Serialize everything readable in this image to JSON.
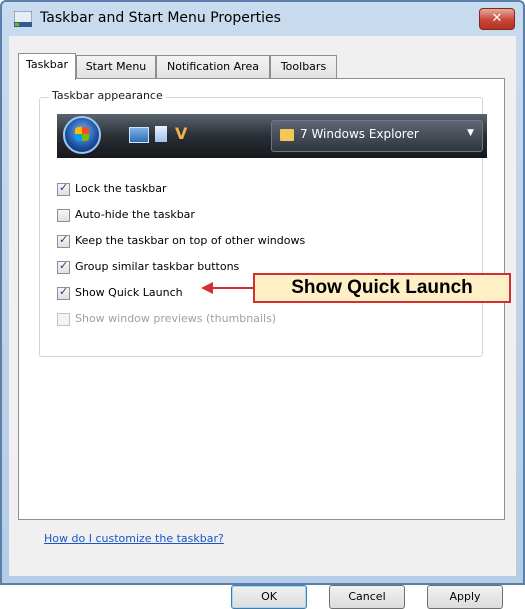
{
  "window": {
    "title": "Taskbar and Start Menu Properties",
    "close_label": "✕"
  },
  "tabs": [
    {
      "label": "Taskbar",
      "active": true
    },
    {
      "label": "Start Menu",
      "active": false
    },
    {
      "label": "Notification Area",
      "active": false
    },
    {
      "label": "Toolbars",
      "active": false
    }
  ],
  "group": {
    "label": "Taskbar appearance"
  },
  "taskbar_preview": {
    "button_label": "7 Windows Explorer",
    "arrow": "▼",
    "ql_icon": "V"
  },
  "options": [
    {
      "label": "Lock the taskbar",
      "checked": true,
      "enabled": true
    },
    {
      "label": "Auto-hide the taskbar",
      "checked": false,
      "enabled": true
    },
    {
      "label": "Keep the taskbar on top of other windows",
      "checked": true,
      "enabled": true
    },
    {
      "label": "Group similar taskbar buttons",
      "checked": true,
      "enabled": true
    },
    {
      "label": "Show Quick Launch",
      "checked": true,
      "enabled": true
    },
    {
      "label": "Show window previews (thumbnails)",
      "checked": false,
      "enabled": false
    }
  ],
  "checkmark": "✓",
  "callout": {
    "text": "Show Quick Launch"
  },
  "help_link": "How do I customize the taskbar?",
  "buttons": {
    "ok": "OK",
    "cancel": "Cancel",
    "apply": "Apply"
  }
}
